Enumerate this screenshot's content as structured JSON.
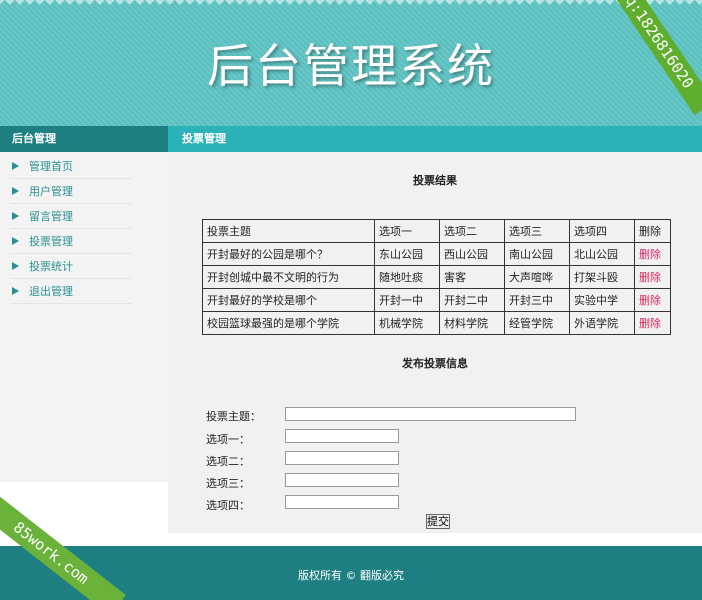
{
  "header": {
    "title": "后台管理系统",
    "qq_ribbon": "qq:1826816020"
  },
  "sidebar": {
    "title": "后台管理",
    "items": [
      {
        "label": "管理首页"
      },
      {
        "label": "用户管理"
      },
      {
        "label": "留言管理"
      },
      {
        "label": "投票管理"
      },
      {
        "label": "投票统计"
      },
      {
        "label": "退出管理"
      }
    ]
  },
  "main": {
    "title": "投票管理",
    "results_title": "投票结果",
    "table": {
      "headers": [
        "投票主题",
        "选项一",
        "选项二",
        "选项三",
        "选项四",
        "删除"
      ],
      "rows": [
        [
          "开封最好的公园是哪个？",
          "东山公园",
          "西山公园",
          "南山公园",
          "北山公园",
          "删除"
        ],
        [
          "开封创城中最不文明的行为",
          "随地吐痰",
          "害客",
          "大声喧哗",
          "打架斗殴",
          "删除"
        ],
        [
          "开封最好的学校是哪个",
          "开封一中",
          "开封二中",
          "开封三中",
          "实验中学",
          "删除"
        ],
        [
          "校园篮球最强的是哪个学院",
          "机械学院",
          "材料学院",
          "经管学院",
          "外语学院",
          "删除"
        ]
      ]
    },
    "publish_title": "发布投票信息",
    "form": {
      "topic_label": "投票主题：",
      "opt1_label": "选项一：",
      "opt2_label": "选项二：",
      "opt3_label": "选项三：",
      "opt4_label": "选项四：",
      "submit_label": "提交"
    }
  },
  "footer": {
    "text": "版权所有 © 翻版必究"
  },
  "watermark": {
    "text": "85work.com"
  },
  "colors": {
    "teal_dark": "#1e7f82",
    "teal_header": "#5fc4c4",
    "teal_bar": "#2bb1b8",
    "delete_red": "#e0245e",
    "ribbon_green": "#5fae2f"
  }
}
